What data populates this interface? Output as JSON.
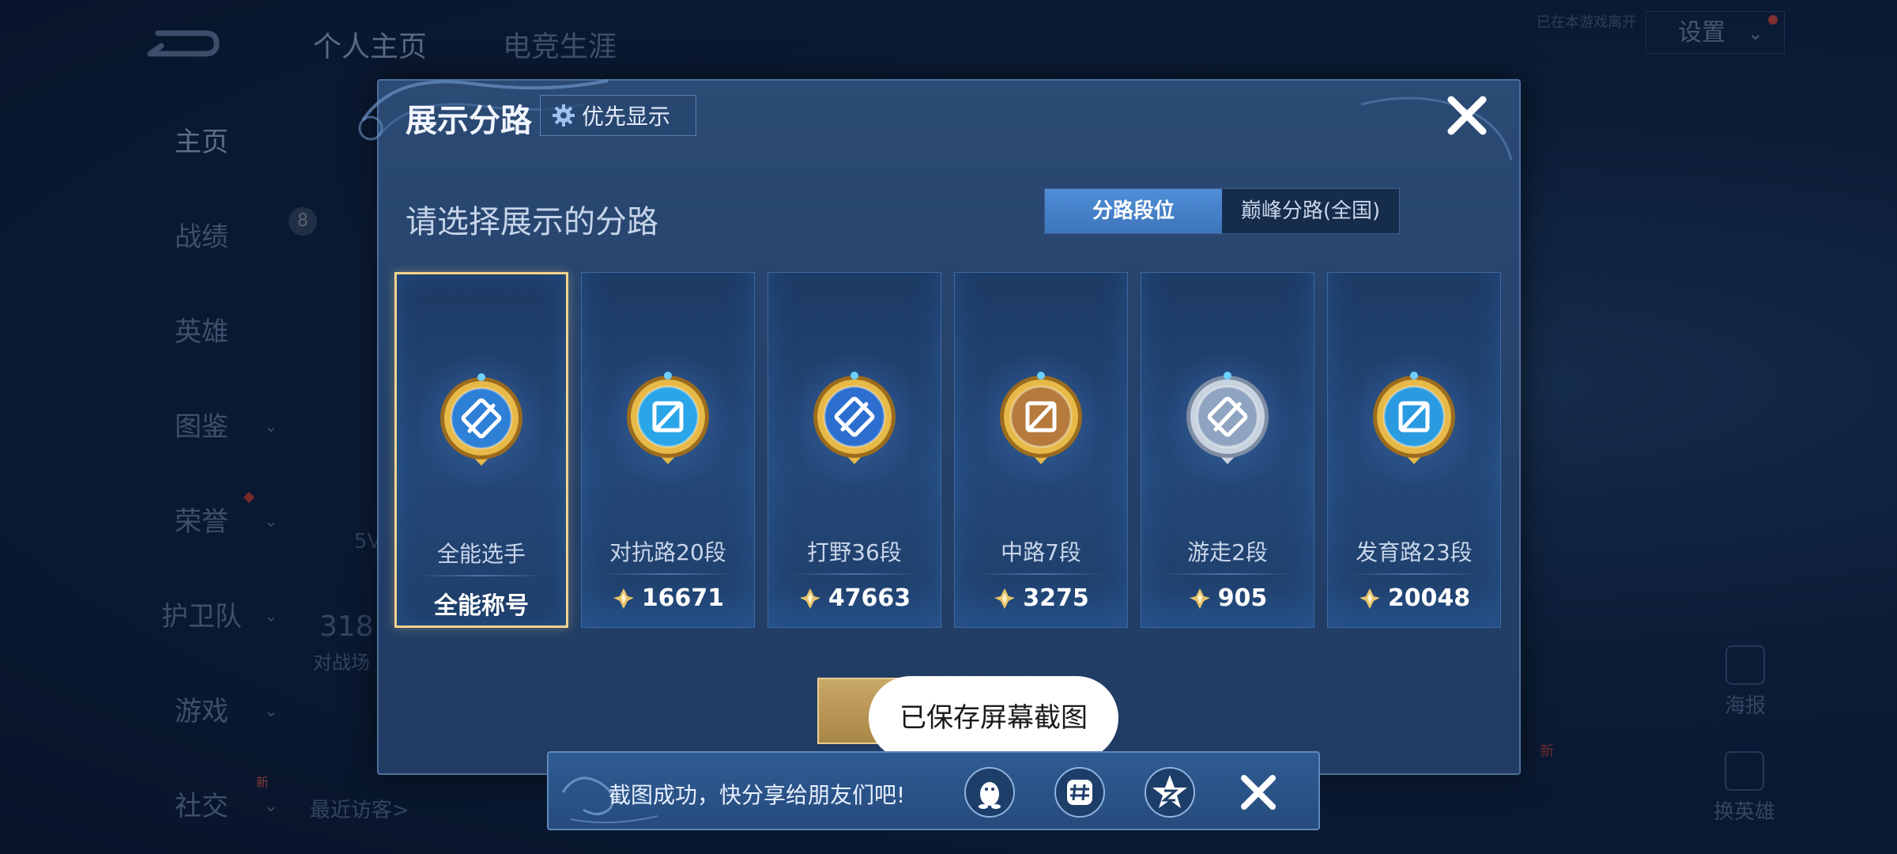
{
  "background": {
    "tabs": [
      "个人主页",
      "电竞生涯"
    ],
    "settings_label": "设置",
    "online_status": "已在本游戏离开",
    "sidebar": [
      "主页",
      "战绩",
      "英雄",
      "图鉴",
      "荣誉",
      "护卫队",
      "游戏",
      "社交"
    ],
    "sidebar_chevrons": [
      false,
      false,
      false,
      true,
      true,
      true,
      true,
      true
    ],
    "fragments": {
      "level": "8",
      "count": "318",
      "count_label": "对战场",
      "recent_visitors": "最近访客>",
      "small": "5V",
      "new_tag": "新"
    },
    "poster_label": "海报",
    "swap_label": "换英雄"
  },
  "dialog": {
    "title": "展示分路",
    "priority_label": "优先显示",
    "section_title": "请选择展示的分路",
    "segments": [
      {
        "label": "分路段位",
        "active": true
      },
      {
        "label": "巅峰分路(全国)",
        "active": false
      }
    ],
    "cards": [
      {
        "rank": "全能选手",
        "value": "全能称号",
        "has_points_icon": false,
        "selected": true,
        "badge_color": "#2e7fd6",
        "badge_icon": "versatile-badge-icon"
      },
      {
        "rank": "对抗路20段",
        "value": "16671",
        "has_points_icon": true,
        "selected": false,
        "badge_color": "#2aa6e8",
        "badge_icon": "clash-lane-badge-icon"
      },
      {
        "rank": "打野36段",
        "value": "47663",
        "has_points_icon": true,
        "selected": false,
        "badge_color": "#2c6fd0",
        "badge_icon": "jungle-badge-icon"
      },
      {
        "rank": "中路7段",
        "value": "3275",
        "has_points_icon": true,
        "selected": false,
        "badge_color": "#b57a3c",
        "badge_icon": "mid-lane-badge-icon"
      },
      {
        "rank": "游走2段",
        "value": "905",
        "has_points_icon": true,
        "selected": false,
        "badge_color": "#8fa4c0",
        "badge_icon": "roam-badge-icon"
      },
      {
        "rank": "发育路23段",
        "value": "20048",
        "has_points_icon": true,
        "selected": false,
        "badge_color": "#2a9be0",
        "badge_icon": "farm-lane-badge-icon"
      }
    ]
  },
  "toast": "已保存屏幕截图",
  "share_bar": {
    "text": "截图成功，快分享给朋友们吧!",
    "icons": [
      "qq-icon",
      "moments-icon",
      "qzone-icon"
    ]
  },
  "colors": {
    "gold": "#f3d38a",
    "accent": "#4f8fd8",
    "panel": "#24416a"
  }
}
